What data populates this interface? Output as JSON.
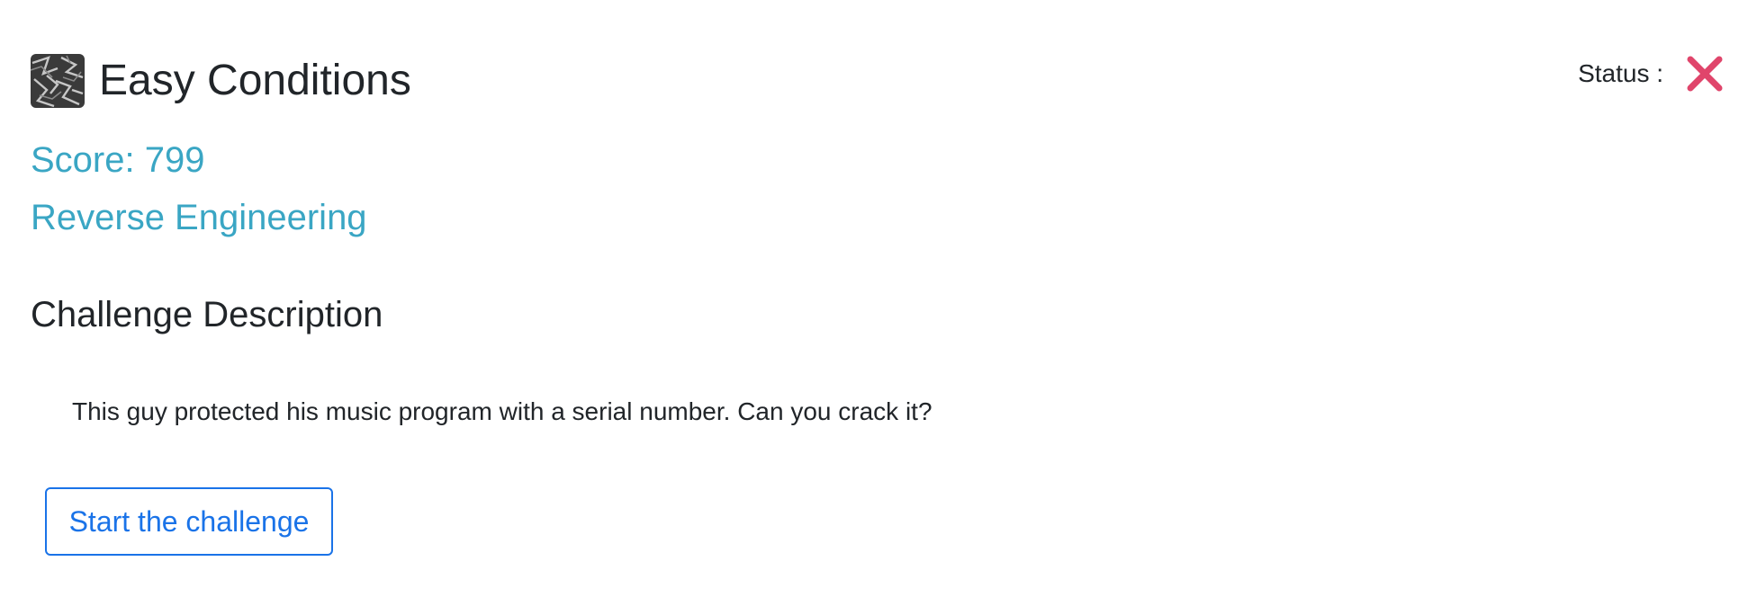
{
  "challenge": {
    "thumbnail_icon": "challenge-thumbnail-image",
    "title": "Easy Conditions",
    "score_text": "Score: 799",
    "category": "Reverse Engineering"
  },
  "status": {
    "label": "Status :",
    "icon": "x-mark-icon",
    "icon_color": "#e0456b"
  },
  "description": {
    "heading": "Challenge Description",
    "text": "This guy protected his music program with a serial number. Can you crack it?"
  },
  "actions": {
    "start_label": "Start the challenge"
  },
  "colors": {
    "accent": "#3aa6c4",
    "button": "#1a73e8",
    "text": "#212529"
  }
}
